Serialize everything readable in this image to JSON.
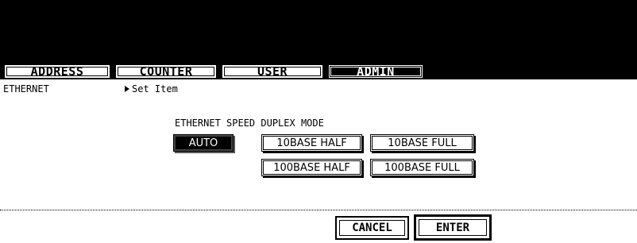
{
  "tabs": [
    {
      "label": "ADDRESS",
      "active": false
    },
    {
      "label": "COUNTER",
      "active": false
    },
    {
      "label": "USER",
      "active": false
    },
    {
      "label": "ADMIN",
      "active": true
    }
  ],
  "breadcrumb": {
    "section": "ETHERNET",
    "subsection": "Set Item"
  },
  "speed_duplex": {
    "title": "ETHERNET SPEED DUPLEX MODE",
    "selected": "AUTO",
    "options": [
      "AUTO",
      "10BASE HALF",
      "10BASE FULL",
      "100BASE HALF",
      "100BASE FULL"
    ]
  },
  "actions": {
    "cancel_label": "CANCEL",
    "enter_label": "ENTER"
  }
}
